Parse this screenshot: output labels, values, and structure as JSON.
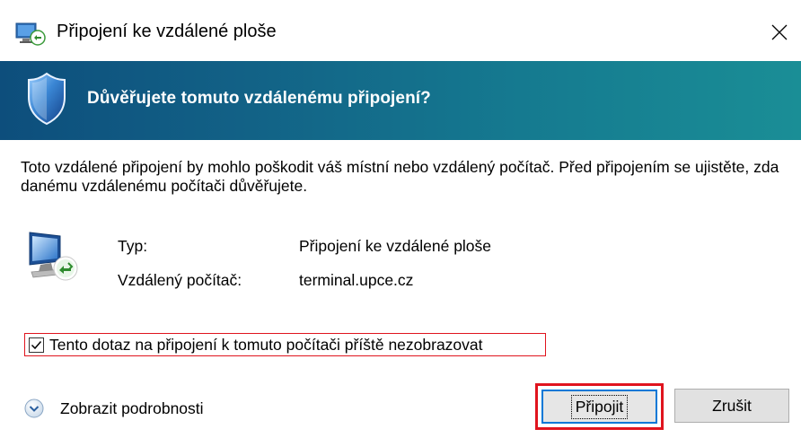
{
  "window": {
    "title": "Připojení ke vzdálené ploše",
    "app_icon": "remote-desktop-icon",
    "close_icon": "close-icon"
  },
  "banner": {
    "title": "Důvěřujete tomuto vzdálenému připojení?",
    "icon": "shield-icon",
    "gradient_start": "#0d4e7c",
    "gradient_end": "#1a8e96"
  },
  "warning_text": "Toto vzdálené připojení by mohlo poškodit váš místní nebo vzdálený počítač. Před připojením se ujistěte, zda danému vzdálenému počítači důvěřujete.",
  "details": {
    "icon": "remote-computer-icon",
    "type_label": "Typ:",
    "type_value": "Připojení ke vzdálené ploše",
    "remote_label": "Vzdálený počítač:",
    "remote_value": "terminal.upce.cz"
  },
  "checkbox": {
    "label": "Tento dotaz na připojení k tomuto počítači příště nezobrazovat",
    "checked": true
  },
  "show_details": {
    "label": "Zobrazit podrobnosti",
    "icon": "chevron-down-circle-icon"
  },
  "buttons": {
    "connect": "Připojit",
    "cancel": "Zrušit"
  },
  "highlight_color": "#e0141e",
  "focus_color": "#0078d7"
}
